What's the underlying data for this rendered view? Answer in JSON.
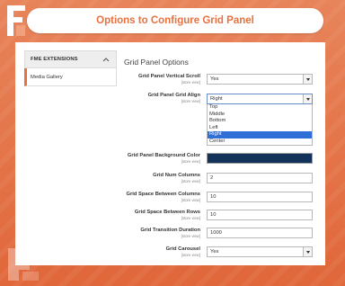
{
  "header": {
    "title": "Options to Configure Grid Panel"
  },
  "sidebar": {
    "section_label": "FME EXTENSIONS",
    "items": [
      {
        "label": "Media Gallery"
      }
    ]
  },
  "main": {
    "section_title": "Grid Panel Options",
    "scope_label": "[store view]",
    "fields": {
      "vertical_scroll": {
        "label": "Grid Panel Vertical Scroll",
        "value": "Yes"
      },
      "grid_align": {
        "label": "Grid Panel Grid Align",
        "value": "Right",
        "options": [
          "Top",
          "Middle",
          "Bottom",
          "Left",
          "Right",
          "Center"
        ],
        "selected_option": "Right"
      },
      "background_color": {
        "label": "Grid Panel Background Color",
        "color": "#12325a"
      },
      "num_columns": {
        "label": "Grid Num Columns",
        "value": "2"
      },
      "space_columns": {
        "label": "Grid Space Between Columns",
        "value": "10"
      },
      "space_rows": {
        "label": "Grid Space Between Rows",
        "value": "10"
      },
      "transition_duration": {
        "label": "Grid Transition Duration",
        "value": "1000"
      },
      "carousel": {
        "label": "Grid Carousel",
        "value": "Yes"
      }
    }
  },
  "colors": {
    "accent": "#e8713f",
    "selected_option": "#2f6fd6"
  }
}
